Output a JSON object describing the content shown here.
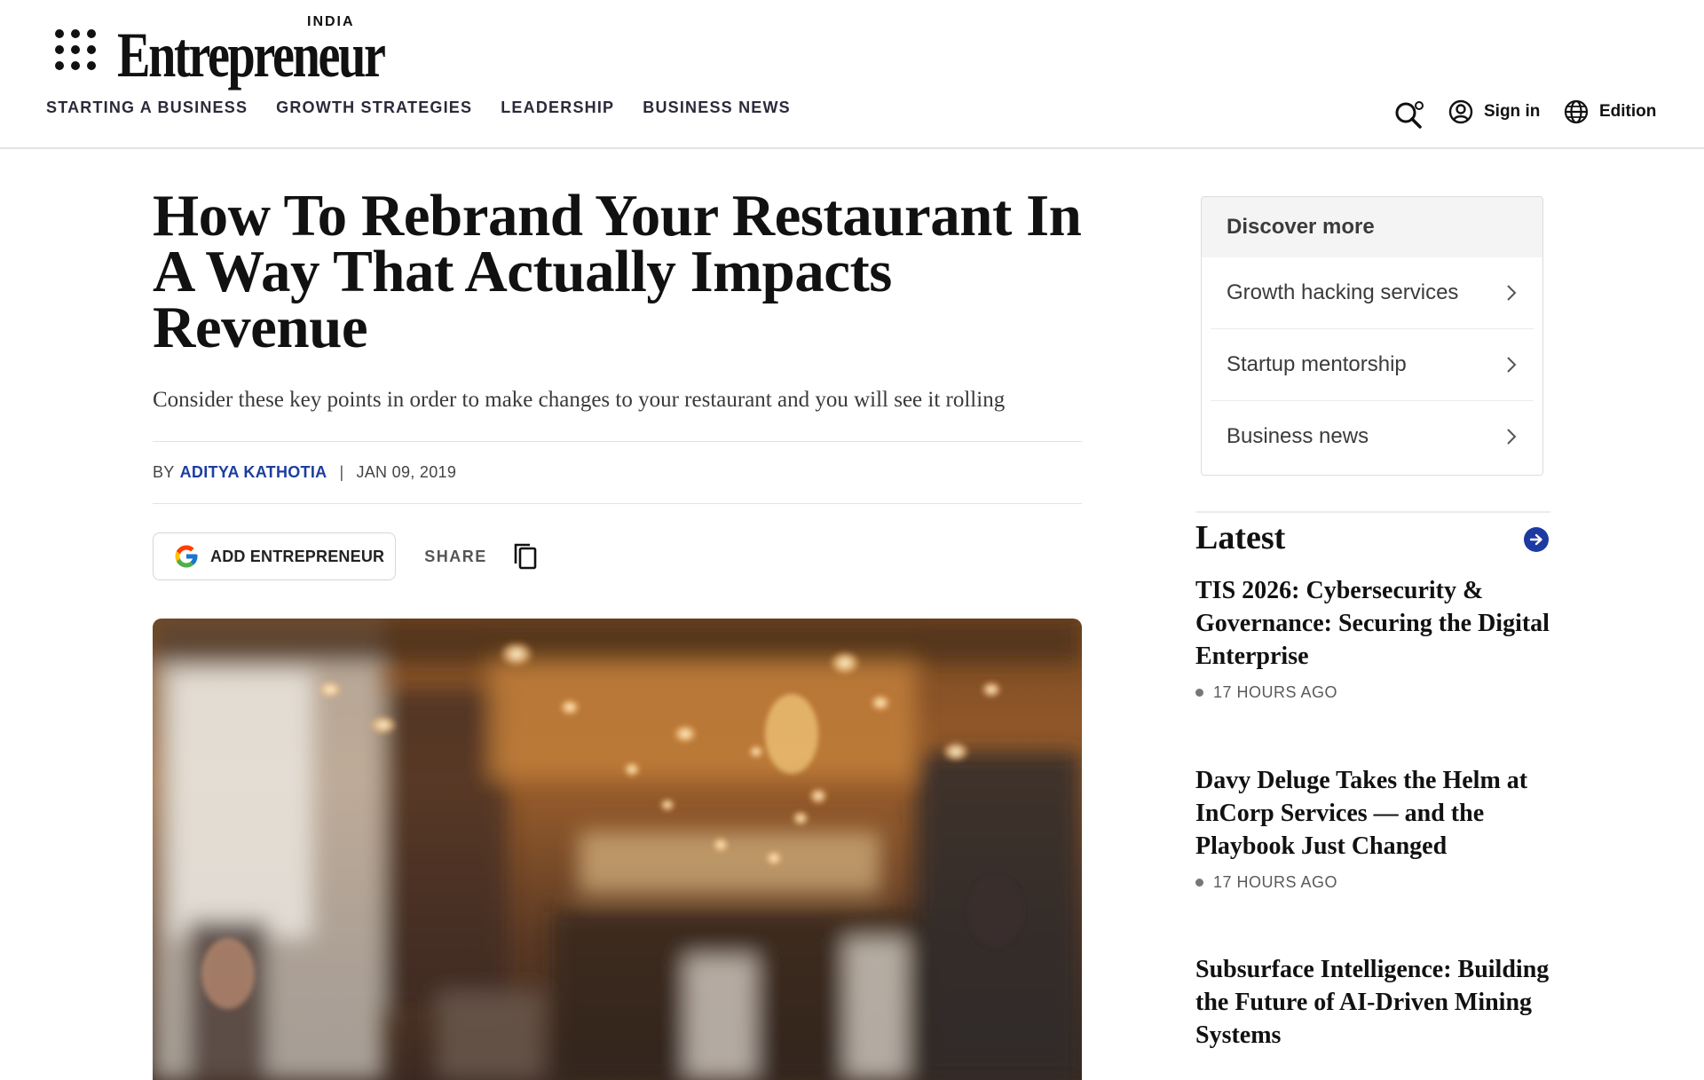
{
  "header": {
    "edition_tag": "INDIA",
    "wordmark": "Entrepreneur",
    "nav": [
      "STARTING A BUSINESS",
      "GROWTH STRATEGIES",
      "LEADERSHIP",
      "BUSINESS NEWS"
    ],
    "sign_in": "Sign in",
    "edition": "Edition",
    "icons": [
      "apps-grid-icon",
      "search-settings-icon",
      "account-icon",
      "globe-icon"
    ]
  },
  "article": {
    "headline": "How To Rebrand Your Restaurant In A Way That Actually Impacts Revenue",
    "dek": "Consider these key points in order to make changes to your restaurant and you will see it rolling",
    "byline_prefix": "BY",
    "author": "ADITYA KATHOTIA",
    "separator": "|",
    "date": "JAN 09, 2019",
    "add_button": "ADD ENTREPRENEUR",
    "share_label": "SHARE",
    "hero_alt": "blurred restaurant interior with warm lights"
  },
  "sidebar": {
    "discover_title": "Discover more",
    "discover_items": [
      "Growth hacking services",
      "Startup mentorship",
      "Business news"
    ],
    "latest_title": "Latest",
    "stories": [
      {
        "title": "TIS 2026: Cybersecurity & Governance: Securing the Digital Enterprise",
        "time": "17 HOURS AGO"
      },
      {
        "title": "Davy Deluge Takes the Helm at InCorp Services — and the Playbook Just Changed",
        "time": "17 HOURS AGO"
      },
      {
        "title": "Subsurface Intelligence: Building the Future of AI-Driven Mining Systems",
        "time": ""
      }
    ]
  },
  "colors": {
    "accent": "#1d3aa3",
    "author_link": "#1d3d9f",
    "text": "#111111"
  }
}
